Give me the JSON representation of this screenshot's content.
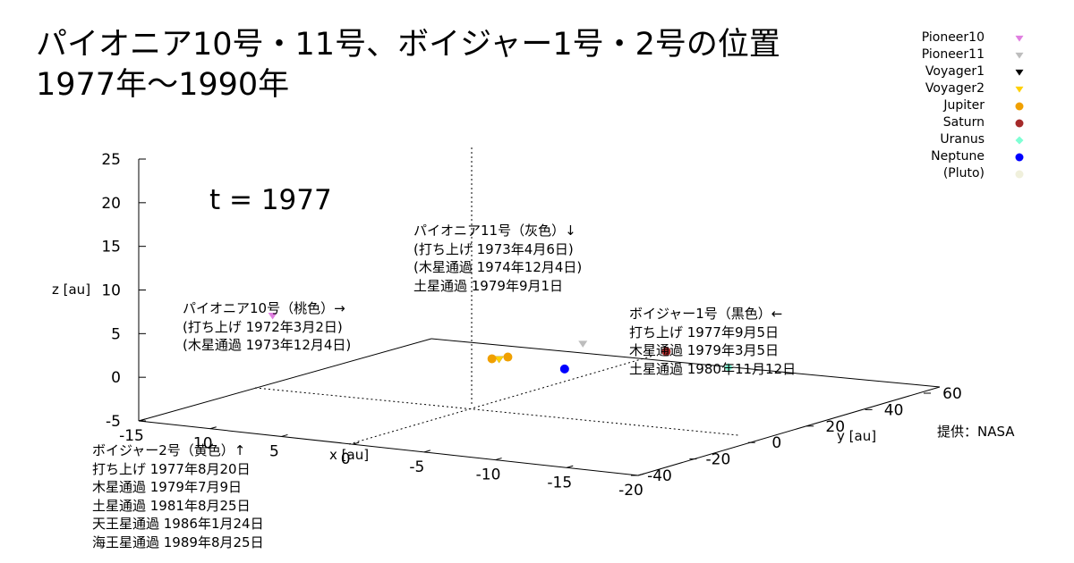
{
  "title": {
    "line1": "パイオニア10号・11号、ボイジャー1号・2号の位置",
    "line2": "1977年〜1990年"
  },
  "time_label": "t = 1977",
  "credit": "提供：NASA",
  "notes": {
    "pioneer10": [
      "パイオニア10号（桃色）→",
      "(打ち上げ 1972年3月2日)",
      "(木星通過 1973年12月4日)"
    ],
    "pioneer11": [
      "パイオニア11号（灰色）↓",
      "(打ち上げ 1973年4月6日)",
      "(木星通過 1974年12月4日)",
      "土星通過 1979年9月1日"
    ],
    "voyager1": [
      "ボイジャー1号（黒色）←",
      "打ち上げ 1977年9月5日",
      "木星通過 1979年3月5日",
      "土星通過 1980年11月12日"
    ],
    "voyager2": [
      "ボイジャー2号（黄色）↑",
      "打ち上げ 1977年8月20日",
      "木星通過 1979年7月9日",
      "土星通過 1981年8月25日",
      "天王星通過 1986年1月24日",
      "海王星通過 1989年8月25日"
    ]
  },
  "chart_data": {
    "type": "scatter",
    "dimensions": 3,
    "time": 1977,
    "axes": {
      "x": {
        "label": "x [au]",
        "range": [
          -20,
          15
        ],
        "ticks": [
          15,
          10,
          5,
          0,
          -5,
          -10,
          -15,
          -20
        ],
        "tick_labels": [
          "-15",
          "10",
          "5",
          "0",
          "-5",
          "-10",
          "-15",
          "-20"
        ]
      },
      "y": {
        "label": "y [au]",
        "range": [
          -40,
          60
        ],
        "ticks": [
          -40,
          -20,
          0,
          20,
          40,
          60
        ],
        "tick_labels": [
          "-40",
          "-20",
          "0",
          "20",
          "40",
          "60"
        ]
      },
      "z": {
        "label": "z [au]",
        "range": [
          -5,
          25
        ],
        "ticks": [
          -5,
          0,
          5,
          10,
          15,
          20,
          25
        ],
        "tick_labels": [
          "-5",
          "0",
          "5",
          "10",
          "15",
          "20",
          "25"
        ]
      }
    },
    "legend_position": "top-right",
    "series": [
      {
        "name": "Pioneer10",
        "marker": "triangle-down",
        "color": "#e07ee0",
        "points": [
          {
            "x": 13,
            "y": -4,
            "z": 4
          }
        ]
      },
      {
        "name": "Pioneer11",
        "marker": "triangle-down",
        "color": "#bdbdbd",
        "points": [
          {
            "x": -3,
            "y": 24,
            "z": 1
          }
        ]
      },
      {
        "name": "Voyager1",
        "marker": "triangle-down",
        "color": "#000000",
        "points": [
          {
            "x": 0,
            "y": 10,
            "z": 0
          }
        ]
      },
      {
        "name": "Voyager2",
        "marker": "triangle-down",
        "color": "#ffd000",
        "points": [
          {
            "x": 0,
            "y": 10,
            "z": 0
          }
        ]
      },
      {
        "name": "Jupiter",
        "marker": "circle",
        "color": "#f0a000",
        "points": [
          {
            "x": 0.5,
            "y": 10,
            "z": 0
          },
          {
            "x": 0,
            "y": 13,
            "z": 0
          }
        ]
      },
      {
        "name": "Saturn",
        "marker": "circle",
        "color": "#a52a2a",
        "points": [
          {
            "x": -7,
            "y": 33,
            "z": 0
          }
        ]
      },
      {
        "name": "Uranus",
        "marker": "diamond",
        "color": "#7fffd4",
        "points": [
          {
            "x": -13,
            "y": 25,
            "z": 0
          }
        ]
      },
      {
        "name": "Neptune",
        "marker": "circle",
        "color": "#0000ff",
        "points": [
          {
            "x": -5,
            "y": 8,
            "z": 0
          }
        ]
      },
      {
        "name": "(Pluto)",
        "marker": "circle",
        "color": "#f0f0dc",
        "points": []
      }
    ]
  }
}
